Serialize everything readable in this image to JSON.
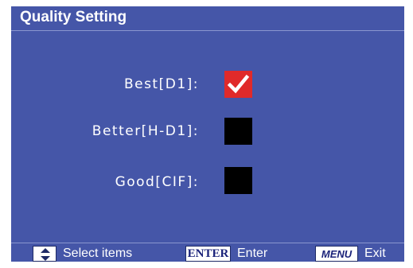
{
  "window": {
    "title": "Quality Setting"
  },
  "options": [
    {
      "label": "Best[D1]:",
      "checked": true
    },
    {
      "label": "Better[H-D1]:",
      "checked": false
    },
    {
      "label": "Good[CIF]:",
      "checked": false
    }
  ],
  "footer": {
    "select_icon": "up-down-arrows-icon",
    "select_label": "Select items",
    "enter_key": "ENTER",
    "enter_label": "Enter",
    "menu_key": "MENU",
    "exit_label": "Exit"
  },
  "colors": {
    "panel_background": "#4556a8",
    "checked_box": "#e02a2a",
    "unchecked_box": "#000000",
    "text": "#ffffff"
  }
}
